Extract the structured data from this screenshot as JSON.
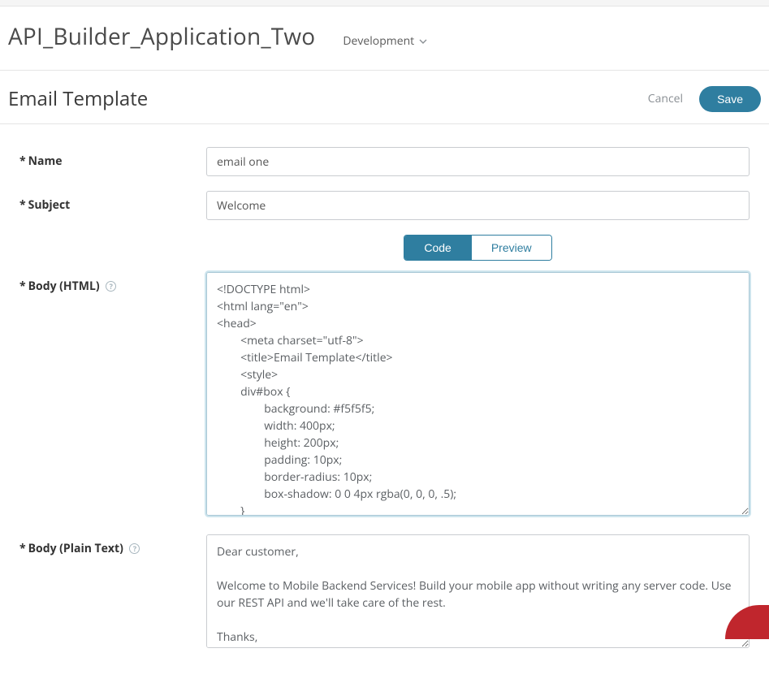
{
  "app": {
    "title": "API_Builder_Application_Two",
    "environment": "Development"
  },
  "page": {
    "title": "Email Template",
    "cancel_label": "Cancel",
    "save_label": "Save"
  },
  "form": {
    "name": {
      "label": "Name",
      "value": "email one"
    },
    "subject": {
      "label": "Subject",
      "value": "Welcome"
    },
    "toggle": {
      "code": "Code",
      "preview": "Preview"
    },
    "body_html": {
      "label": "Body (HTML)",
      "value": "<!DOCTYPE html>\n<html lang=\"en\">\n<head>\n        <meta charset=\"utf-8\">\n        <title>Email Template</title>\n        <style>\n        div#box {\n                background: #f5f5f5;\n                width: 400px;\n                height: 200px;\n                padding: 10px;\n                border-radius: 10px;\n                box-shadow: 0 0 4px rgba(0, 0, 0, .5);\n        }"
    },
    "body_plain": {
      "label": "Body (Plain Text)",
      "value": "Dear customer,\n\nWelcome to Mobile Backend Services! Build your mobile app without writing any server code. Use our REST API and we'll take care of the rest.\n\nThanks,"
    },
    "help_glyph": "?"
  }
}
